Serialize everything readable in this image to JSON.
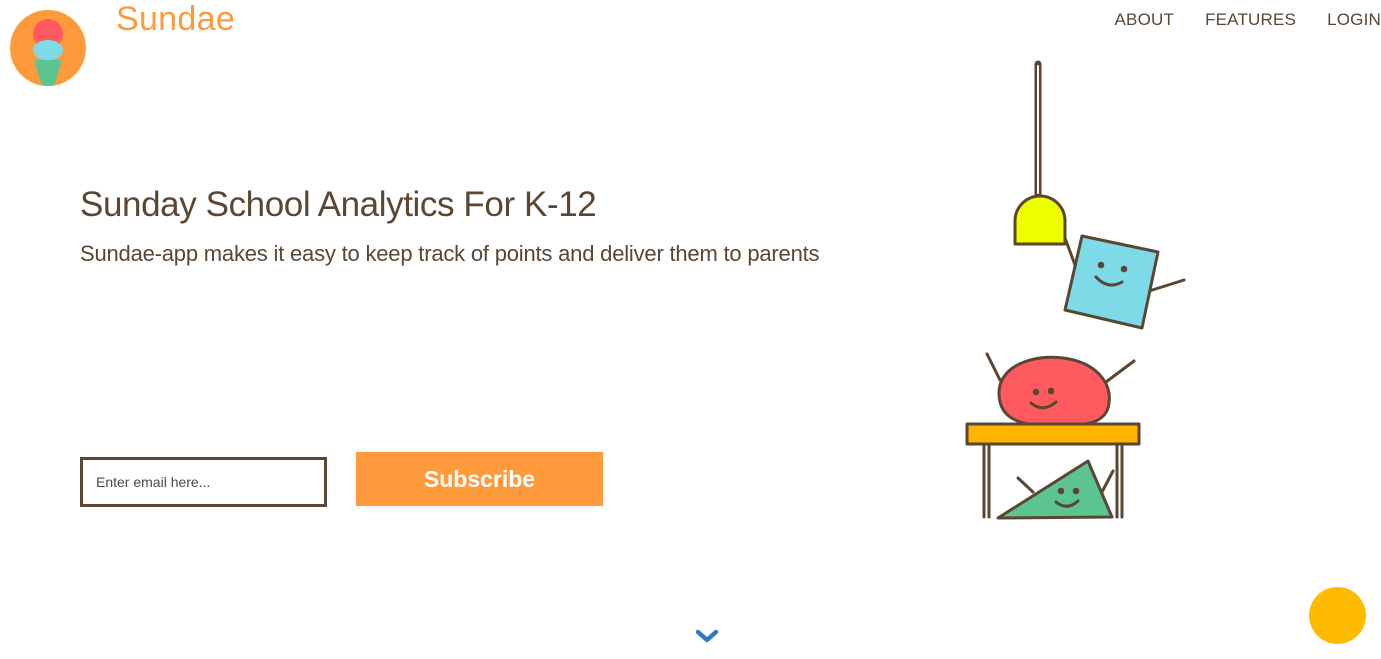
{
  "brand": {
    "name": "Sundae",
    "logo_icon": "ice-cream-icon",
    "colors": {
      "accent": "#ff9a3c",
      "text": "#5a4632",
      "scoop_pink": "#ff5a5f",
      "scoop_blue": "#7ddbe8",
      "cone_green": "#5cc490"
    }
  },
  "nav": {
    "items": [
      {
        "label": "ABOUT"
      },
      {
        "label": "FEATURES"
      },
      {
        "label": "LOGIN"
      }
    ]
  },
  "hero": {
    "title": "Sunday School Analytics For K-12",
    "subtitle": "Sundae-app makes it easy to keep track of points and deliver them to parents"
  },
  "form": {
    "email_placeholder": "Enter email here...",
    "email_value": "",
    "subscribe_label": "Subscribe"
  },
  "illustration": {
    "icon": "classroom-shapes-illustration",
    "colors": {
      "lamp": "#eeff00",
      "square": "#7ddbe8",
      "blob": "#ff5a5f",
      "desk": "#ffb400",
      "triangle": "#5cc490",
      "outline": "#5a4632"
    }
  },
  "scroll_indicator": {
    "icon": "chevron-down-icon",
    "color": "#2f7bbf"
  },
  "fab": {
    "color": "#ffbb00"
  }
}
